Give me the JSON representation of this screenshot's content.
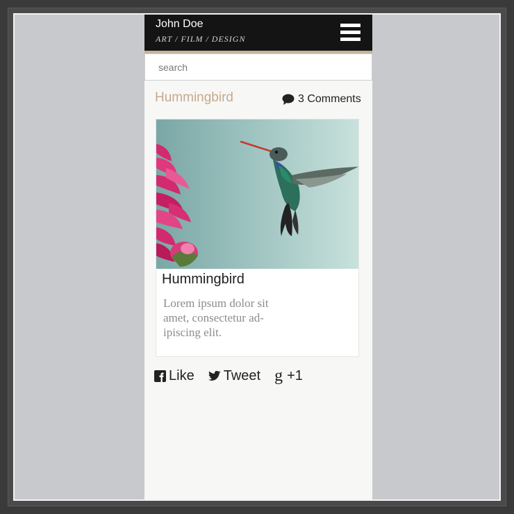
{
  "header": {
    "name": "John Doe",
    "tagline": "ART  /  FILM  /  DESIGN",
    "menu_icon": "hamburger-menu-icon"
  },
  "search": {
    "placeholder": "search",
    "value": ""
  },
  "post": {
    "title": "Hummingbird",
    "comments_label": "3 Comments",
    "comment_icon": "speech-bubble-icon"
  },
  "card": {
    "title": "Hummingbird",
    "text": "Lorem ipsum dolor sit amet, consectetur ad-ipiscing elit."
  },
  "social": {
    "like_label": "Like",
    "tweet_label": "Tweet",
    "gplus_g": "g",
    "gplus_label": "+1"
  },
  "colors": {
    "header_bg": "#141414",
    "accent_tan": "#c4b49a",
    "post_title": "#c6a98a",
    "canvas_bg": "#c8c9cd"
  }
}
